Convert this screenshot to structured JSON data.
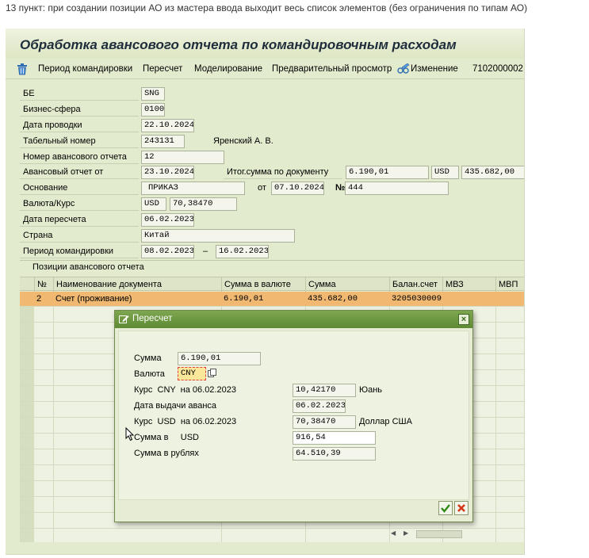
{
  "caption": "13 пункт: при создании позиции АО из мастера ввода выходит весь список элементов (без ограничения по типам АО)",
  "window": {
    "title": "Обработка авансового отчета по командировочным расходам"
  },
  "toolbar": {
    "items": [
      "Период командировки",
      "Пересчет",
      "Моделирование",
      "Предварительный просмотр",
      "Изменение",
      "7102000002"
    ]
  },
  "form": {
    "be_label": "БЕ",
    "be_value": "SNG",
    "bs_label": "Бизнес-сфера",
    "bs_value": "0100",
    "posting_date_label": "Дата проводки",
    "posting_date_value": "22.10.2024",
    "tab_label": "Табельный номер",
    "tab_value": "243131",
    "employee_name": "Яренский А. В.",
    "report_no_label": "Номер авансового отчета",
    "report_no_value": "12",
    "report_from_label": "Авансовый отчет от",
    "report_from_value": "23.10.2024",
    "total_label": "Итог.сумма по документу",
    "total_value": "6.190,01",
    "total_currency": "USD",
    "total_rub": "435.682,00",
    "basis_label": "Основание",
    "basis_value": "ПРИКАЗ",
    "basis_from_label": "от",
    "basis_date": "07.10.2024",
    "basis_no_label": "№",
    "basis_no_value": "444",
    "currency_label": "Валюта/Курс",
    "currency_value": "USD",
    "rate_value": "70,38470",
    "recalc_date_label": "Дата пересчета",
    "recalc_date_value": "06.02.2023",
    "country_label": "Страна",
    "country_value": "Китай",
    "trip_label": "Период командировки",
    "trip_from": "08.02.2023",
    "trip_dash": "–",
    "trip_to": "16.02.2023"
  },
  "grid": {
    "title": "Позиции авансового отчета",
    "columns": [
      "№",
      "Наименование документа",
      "Сумма в валюте",
      "Сумма",
      "Балан.счет",
      "МВЗ",
      "МВП"
    ],
    "rows": [
      {
        "no": "2",
        "name": "Счет (проживание)",
        "amount_cur": "6.190,01",
        "amount": "435.682,00",
        "account": "3205030009",
        "cc": "",
        "mvp": ""
      }
    ]
  },
  "dialog": {
    "title": "Пересчет",
    "sum_label": "Сумма",
    "sum_value": "6.190,01",
    "cur_label": "Валюта",
    "cur_value": "CNY",
    "rate1_label": "Курс  CNY  на 06.02.2023",
    "rate1_value": "10,42170",
    "rate1_unit": "Юань",
    "adv_date_label": "Дата выдачи аванса",
    "adv_date_value": "06.02.2023",
    "rate2_label": "Курс  USD  на 06.02.2023",
    "rate2_value": "70,38470",
    "rate2_unit": "Доллар США",
    "sum_in_label": "Сумма в     USD",
    "sum_in_value": "916,54",
    "sum_rub_label": "Сумма в рублях",
    "sum_rub_value": "64.510,39"
  },
  "colors": {
    "window_bg": "#e3ebce",
    "selected_row": "#f0b870",
    "dialog_title": "#6a9640"
  }
}
